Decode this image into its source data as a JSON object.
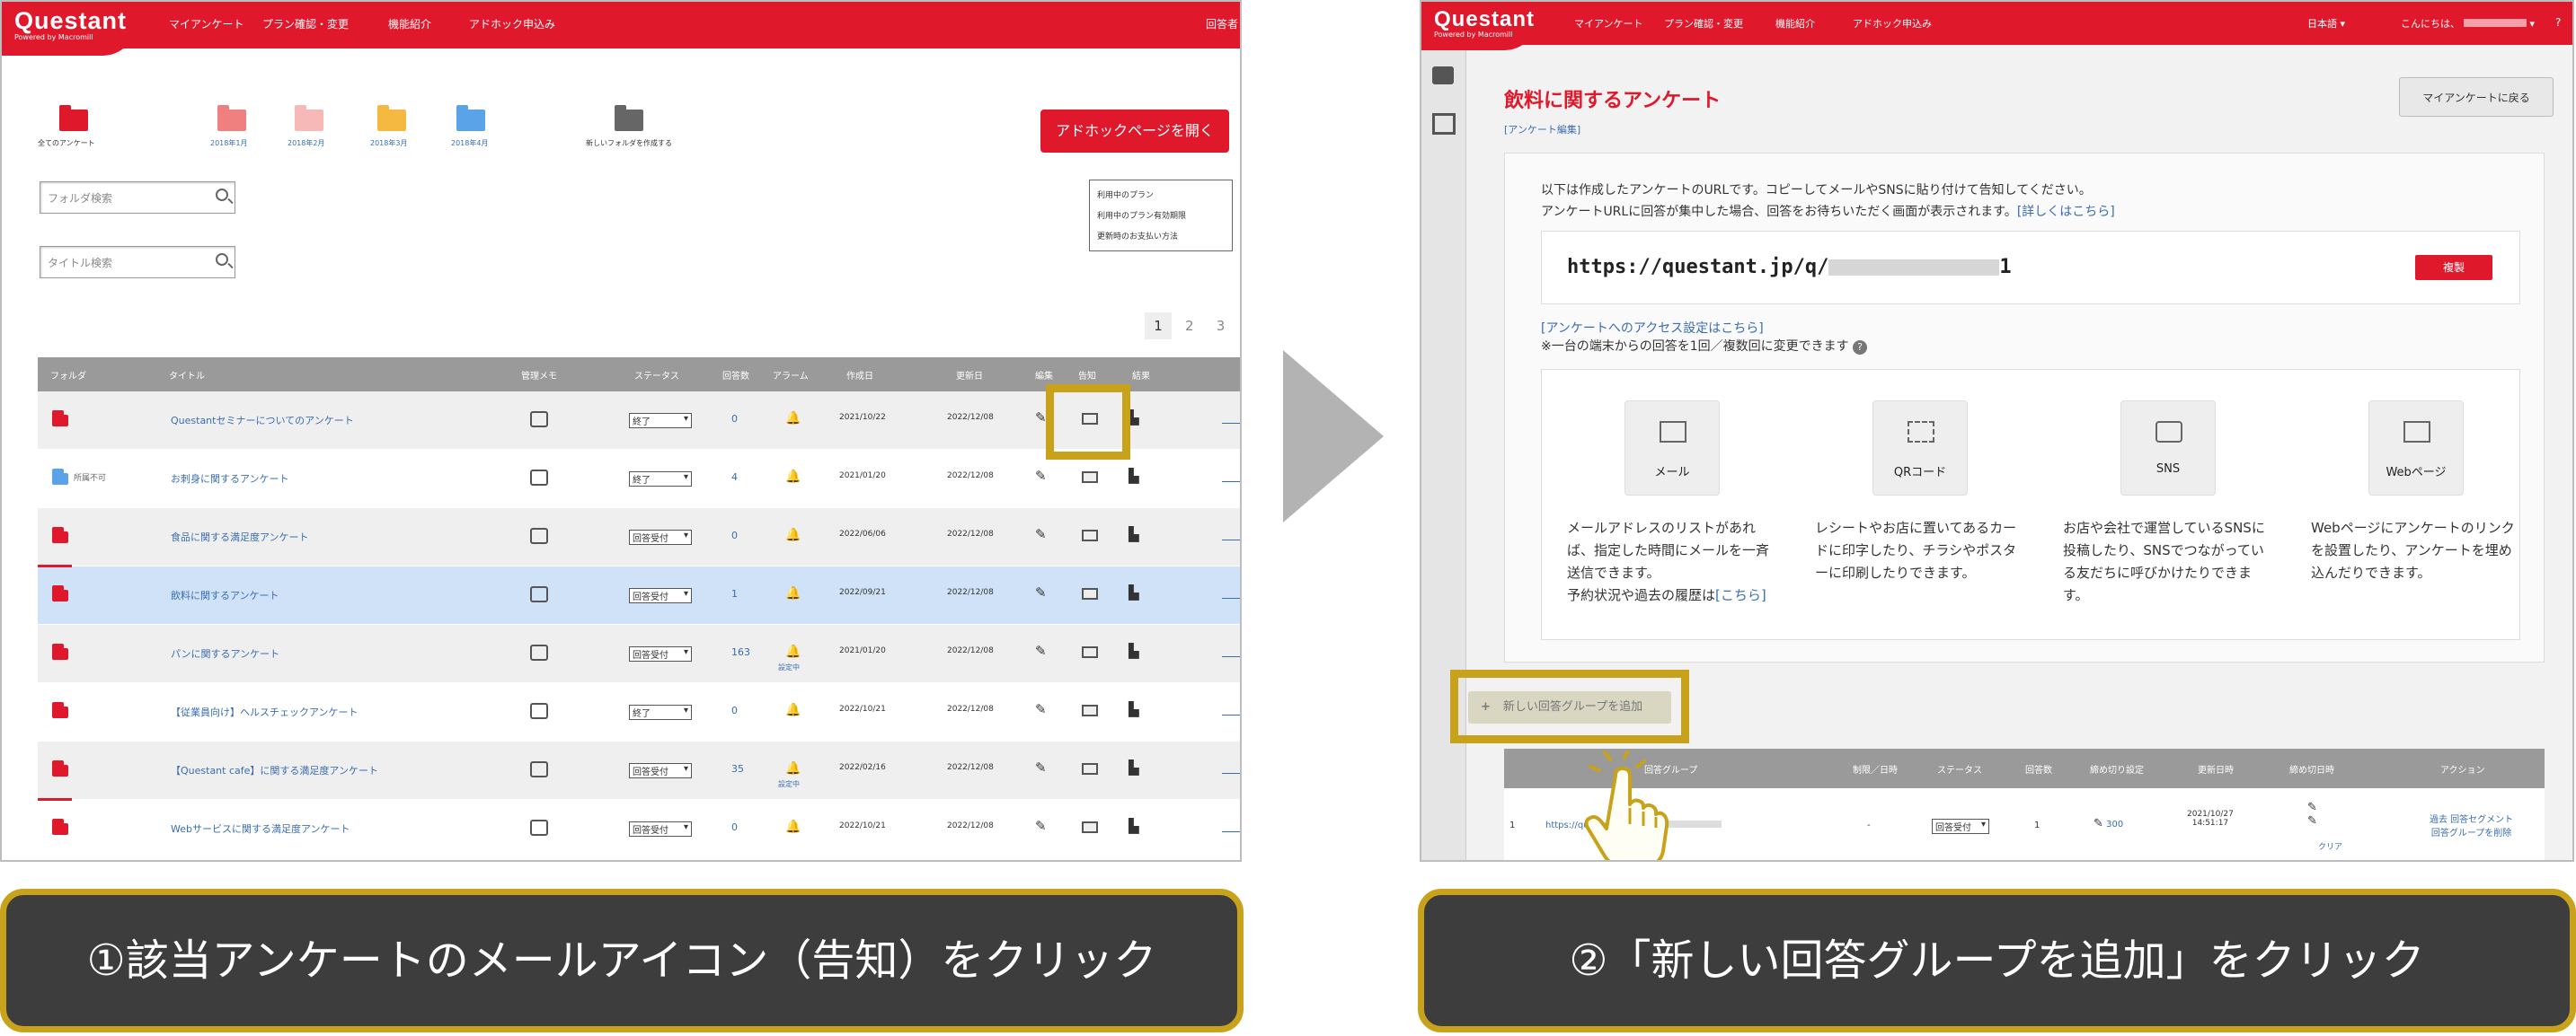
{
  "left_screen": {
    "logo": {
      "name": "Questant",
      "sub": "Powered by Macromill"
    },
    "nav": [
      "マイアンケート",
      "プラン確認・変更",
      "機能紹介",
      "アドホック申込み"
    ],
    "nav_right": "回答者",
    "folders": [
      {
        "label": "全てのアンケート",
        "color": "#e0182c"
      },
      {
        "label": "2018年1月",
        "color": "#f08080"
      },
      {
        "label": "2018年2月",
        "color": "#f7b8b8"
      },
      {
        "label": "2018年3月",
        "color": "#f5b942"
      },
      {
        "label": "2018年4月",
        "color": "#5ba3e8"
      },
      {
        "label": "新しいフォルダを作成する",
        "color": "#666666"
      }
    ],
    "adhoc_button": "アドホックページを開く",
    "folder_search_placeholder": "フォルダ検索",
    "title_search_placeholder": "タイトル検索",
    "plan_links": [
      "利用中のプラン",
      "利用中のプラン有効期限",
      "更新時のお支払い方法"
    ],
    "pagination": [
      "1",
      "2",
      "3"
    ],
    "columns": [
      "フォルダ",
      "タイトル",
      "管理メモ",
      "ステータス",
      "回答数",
      "アラーム",
      "作成日",
      "更新日",
      "編集",
      "告知",
      "結果"
    ],
    "rows": [
      {
        "folder": "",
        "title": "Questantセミナーについてのアンケート",
        "status": "終了",
        "count": "0",
        "created": "2021/10/22",
        "updated": "2022/12/08",
        "alarm_label": ""
      },
      {
        "folder": "所属不可",
        "title": "お刺身に関するアンケート",
        "status": "終了",
        "count": "4",
        "created": "2021/01/20",
        "updated": "2022/12/08",
        "alarm_label": ""
      },
      {
        "folder": "",
        "title": "食品に関する満足度アンケート",
        "status": "回答受付",
        "count": "0",
        "created": "2022/06/06",
        "updated": "2022/12/08",
        "alarm_label": ""
      },
      {
        "folder": "",
        "title": "飲料に関するアンケート",
        "status": "回答受付",
        "count": "1",
        "created": "2022/09/21",
        "updated": "2022/12/08",
        "alarm_label": ""
      },
      {
        "folder": "",
        "title": "パンに関するアンケート",
        "status": "回答受付",
        "count": "163",
        "created": "2021/01/20",
        "updated": "2022/12/08",
        "alarm_label": "設定中"
      },
      {
        "folder": "",
        "title": "【従業員向け】ヘルスチェックアンケート",
        "status": "終了",
        "count": "0",
        "created": "2022/10/21",
        "updated": "2022/12/08",
        "alarm_label": ""
      },
      {
        "folder": "",
        "title": "【Questant cafe】に関する満足度アンケート",
        "status": "回答受付",
        "count": "35",
        "created": "2022/02/16",
        "updated": "2022/12/08",
        "alarm_label": "設定中"
      },
      {
        "folder": "",
        "title": "Webサービスに関する満足度アンケート",
        "status": "回答受付",
        "count": "0",
        "created": "2022/10/21",
        "updated": "2022/12/08",
        "alarm_label": ""
      }
    ]
  },
  "right_screen": {
    "nav": [
      "マイアンケート",
      "プラン確認・変更",
      "機能紹介",
      "アドホック申込み"
    ],
    "lang": "日本語",
    "user": "こんにちは、",
    "help": "?",
    "title": "飲料に関するアンケート",
    "edit_link": "[アンケート編集]",
    "my_survey_button": "マイアンケートに戻る",
    "intro_line1": "以下は作成したアンケートのURLです。コピーしてメールやSNSに貼り付けて告知してください。",
    "intro_line2": "アンケートURLに回答が集中した場合、回答をお待ちいただく画面が表示されます。",
    "intro_link": "[詳しくはこちら]",
    "url": "https://questant.jp/q/",
    "url_suffix": "1",
    "copy_button": "複製",
    "access_link": "[アンケートへのアクセス設定はこちら]",
    "access_note": "※一台の端末からの回答を1回／複数回に変更できます",
    "share_options": [
      {
        "name": "メール",
        "desc": "メールアドレスのリストがあれば、指定した時間にメールを一斉送信できます。\n予約状況や過去の履歴は",
        "link": "[こちら]"
      },
      {
        "name": "QRコード",
        "desc": "レシートやお店に置いてあるカードに印字したり、チラシやポスターに印刷したりできます。",
        "link": ""
      },
      {
        "name": "SNS",
        "desc": "お店や会社で運営しているSNSに投稿したり、SNSでつながっている友だちに呼びかけたりできます。",
        "link": ""
      },
      {
        "name": "Webページ",
        "desc": "Webページにアンケートのリンクを設置したり、アンケートを埋め込んだりできます。",
        "link": ""
      }
    ],
    "add_group_button": "新しい回答グループを追加",
    "group_columns": [
      "回答グループ",
      "制限／日時",
      "ステータス",
      "回答数",
      "締め切り設定",
      "更新日時",
      "締め切日時",
      "アクション"
    ],
    "group_row": {
      "no": "1",
      "url": "https://questant.jp/q/",
      "limit": "-",
      "status": "回答受付",
      "count": "1",
      "deadline": "300",
      "updated": "2021/10/27\n14:51:17",
      "close_label": "クリア",
      "actions": "過去 回答セグメント\n回答グループを削除"
    }
  },
  "captions": {
    "step1": "①該当アンケートのメールアイコン（告知）をクリック",
    "step2": "②「新しい回答グループを追加」をクリック"
  },
  "colors": {
    "brand": "#e0182c",
    "highlight": "#c8a21a",
    "caption_bg": "#3d3d3d",
    "row_selected": "#cfe2f7"
  }
}
